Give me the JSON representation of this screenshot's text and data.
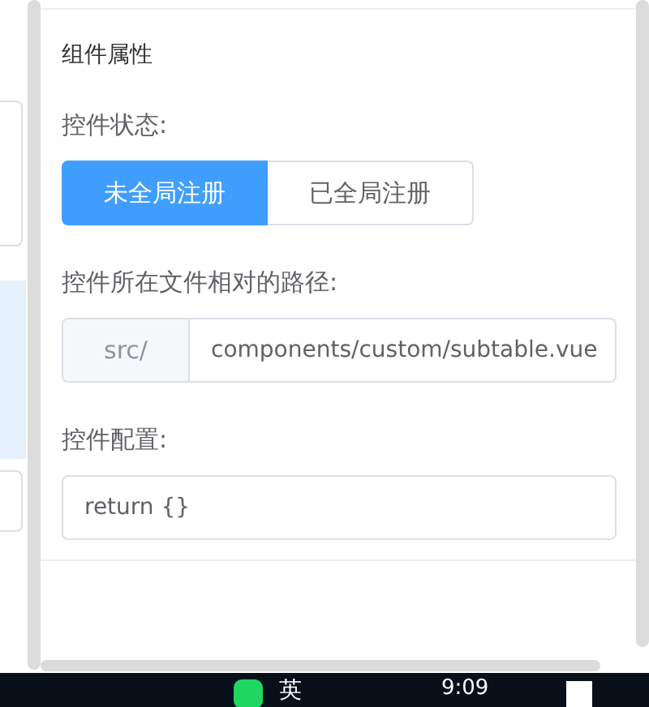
{
  "panel": {
    "title": "组件属性"
  },
  "status": {
    "label": "控件状态:",
    "options": [
      {
        "label": "未全局注册",
        "selected": true
      },
      {
        "label": "已全局注册",
        "selected": false
      }
    ]
  },
  "path": {
    "label": "控件所在文件相对的路径:",
    "prefix": "src/",
    "value": "components/custom/subtable.vue"
  },
  "config": {
    "label": "控件配置:",
    "value": "return {}"
  },
  "taskbar": {
    "ime": "英",
    "clock": "9:09"
  }
}
